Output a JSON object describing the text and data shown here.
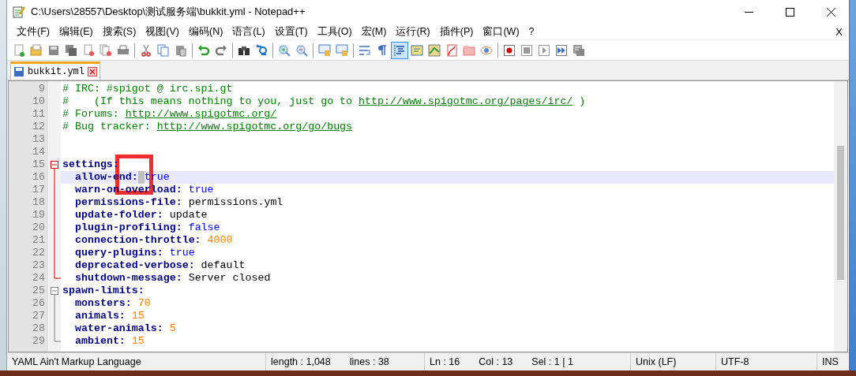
{
  "window": {
    "title": "C:\\Users\\28557\\Desktop\\测试服务端\\bukkit.yml - Notepad++"
  },
  "menu": [
    {
      "label": "文件(F)"
    },
    {
      "label": "编辑(E)"
    },
    {
      "label": "搜索(S)"
    },
    {
      "label": "视图(V)"
    },
    {
      "label": "编码(N)"
    },
    {
      "label": "语言(L)"
    },
    {
      "label": "设置(T)"
    },
    {
      "label": "工具(O)"
    },
    {
      "label": "宏(M)"
    },
    {
      "label": "运行(R)"
    },
    {
      "label": "插件(P)"
    },
    {
      "label": "窗口(W)"
    },
    {
      "label": "?"
    }
  ],
  "menu_close": "X",
  "toolbar": [
    {
      "kind": "new"
    },
    {
      "kind": "open"
    },
    {
      "kind": "save"
    },
    {
      "kind": "save-all"
    },
    {
      "kind": "close"
    },
    {
      "kind": "close-all"
    },
    {
      "kind": "print"
    },
    {
      "kind": "sep"
    },
    {
      "kind": "cut"
    },
    {
      "kind": "copy"
    },
    {
      "kind": "paste"
    },
    {
      "kind": "sep"
    },
    {
      "kind": "undo"
    },
    {
      "kind": "redo"
    },
    {
      "kind": "sep"
    },
    {
      "kind": "find"
    },
    {
      "kind": "replace"
    },
    {
      "kind": "sep"
    },
    {
      "kind": "zoom-in"
    },
    {
      "kind": "zoom-out"
    },
    {
      "kind": "sep"
    },
    {
      "kind": "sync-v"
    },
    {
      "kind": "sync-h"
    },
    {
      "kind": "sep"
    },
    {
      "kind": "wrap",
      "on": false
    },
    {
      "kind": "all-chars",
      "on": false
    },
    {
      "kind": "indent-guide",
      "on": true
    },
    {
      "kind": "lang"
    },
    {
      "kind": "doc-map"
    },
    {
      "kind": "func-list"
    },
    {
      "kind": "folder"
    },
    {
      "kind": "monitor"
    },
    {
      "kind": "sep"
    },
    {
      "kind": "record"
    },
    {
      "kind": "stop"
    },
    {
      "kind": "play"
    },
    {
      "kind": "play-multi"
    },
    {
      "kind": "save-macro"
    }
  ],
  "tabs": [
    {
      "label": "bukkit.yml",
      "selected": true
    }
  ],
  "lines": [
    {
      "number": "9",
      "segments": [
        {
          "kind": "comment",
          "text": "# IRC: #spigot @ irc.spi.gt"
        }
      ]
    },
    {
      "number": "10",
      "segments": [
        {
          "kind": "comment",
          "text": "#    (If this means nothing to you, just go to "
        },
        {
          "kind": "link",
          "text": "http://www.spigotmc.org/pages/irc/"
        },
        {
          "kind": "comment",
          "text": " )"
        }
      ]
    },
    {
      "number": "11",
      "segments": [
        {
          "kind": "comment",
          "text": "# Forums: "
        },
        {
          "kind": "link",
          "text": "http://www.spigotmc.org/"
        }
      ]
    },
    {
      "number": "12",
      "segments": [
        {
          "kind": "comment",
          "text": "# Bug tracker: "
        },
        {
          "kind": "link",
          "text": "http://www.spigotmc.org/go/bugs"
        }
      ]
    },
    {
      "number": "13"
    },
    {
      "number": "14"
    },
    {
      "number": "15",
      "key": "settings:",
      "children": [
        {
          "number": "16",
          "key": "allow-end:",
          "value": "true",
          "kind": "bool",
          "current": true
        },
        {
          "number": "17",
          "key": "warn-on-overload:",
          "value": "true",
          "kind": "bool"
        },
        {
          "number": "18",
          "key": "permissions-file:",
          "value": "permissions.yml",
          "kind": "str"
        },
        {
          "number": "19",
          "key": "update-folder:",
          "value": "update",
          "kind": "str"
        },
        {
          "number": "20",
          "key": "plugin-profiling:",
          "value": "false",
          "kind": "bool"
        },
        {
          "number": "21",
          "key": "connection-throttle:",
          "value": "4000",
          "kind": "num"
        },
        {
          "number": "22",
          "key": "query-plugins:",
          "value": "true",
          "kind": "bool"
        },
        {
          "number": "23",
          "key": "deprecated-verbose:",
          "value": "default",
          "kind": "str"
        },
        {
          "number": "24",
          "key": "shutdown-message:",
          "value": "Server closed",
          "kind": "str"
        }
      ]
    },
    {
      "number": "25",
      "key": "spawn-limits:",
      "children": [
        {
          "number": "26",
          "key": "monsters:",
          "value": "70",
          "kind": "num"
        },
        {
          "number": "27",
          "key": "animals:",
          "value": "15",
          "kind": "num"
        },
        {
          "number": "28",
          "key": "water-animals:",
          "value": "5",
          "kind": "num"
        },
        {
          "number": "29",
          "key": "ambient:",
          "value": "15",
          "kind": "num"
        }
      ]
    }
  ],
  "status_bar": [
    "YAML Ain't Markup Language",
    "length : 1,048",
    "lines : 38",
    "Ln : 16",
    "Col : 13",
    "Sel : 1 | 1",
    "Unix (LF)",
    "UTF-8",
    "INS"
  ]
}
